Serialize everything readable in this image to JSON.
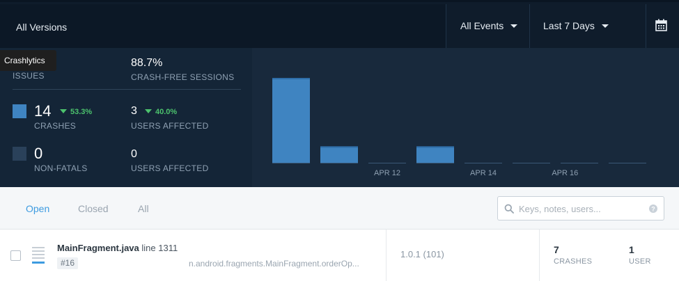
{
  "header": {
    "versions_label": "All Versions",
    "events_label": "All Events",
    "range_label": "Last 7 Days"
  },
  "tooltip": "Crashlytics",
  "stats": {
    "issues_label": "ISSUES",
    "crash_free_value": "88.7%",
    "crash_free_label": "CRASH-FREE SESSIONS",
    "crashes_value": "14",
    "crashes_delta": "53.3%",
    "crashes_label": "CRASHES",
    "crash_users_value": "3",
    "crash_users_delta": "40.0%",
    "crash_users_label": "USERS AFFECTED",
    "nonfatals_value": "0",
    "nonfatals_label": "NON-FATALS",
    "nonfatal_users_value": "0",
    "nonfatal_users_label": "USERS AFFECTED",
    "crash_color": "#3f84c1",
    "nonfatal_color": "#2a415a"
  },
  "chart_data": {
    "type": "bar",
    "categories": [
      "",
      "",
      "APR 12",
      "",
      "APR 14",
      "",
      "APR 16",
      "",
      ""
    ],
    "values": [
      11,
      2.2,
      0,
      2.2,
      0,
      0,
      0,
      0
    ],
    "tick_labels": [
      {
        "text": "APR 12",
        "slot": 2
      },
      {
        "text": "APR 14",
        "slot": 4
      },
      {
        "text": "APR 16",
        "slot": 5.7
      }
    ],
    "bar_color": "#3f84c1",
    "baseline_color": "#3a5878"
  },
  "tabs": {
    "open": "Open",
    "closed": "Closed",
    "all": "All"
  },
  "search": {
    "placeholder": "Keys, notes, users..."
  },
  "issue": {
    "file": "MainFragment.java",
    "line": "line 1311",
    "number": "#16",
    "method": "n.android.fragments.MainFragment.orderOp...",
    "version": "1.0.1 (101)",
    "crashes_count": "7",
    "crashes_label": "CRASHES",
    "users_count": "1",
    "users_label": "USER"
  }
}
